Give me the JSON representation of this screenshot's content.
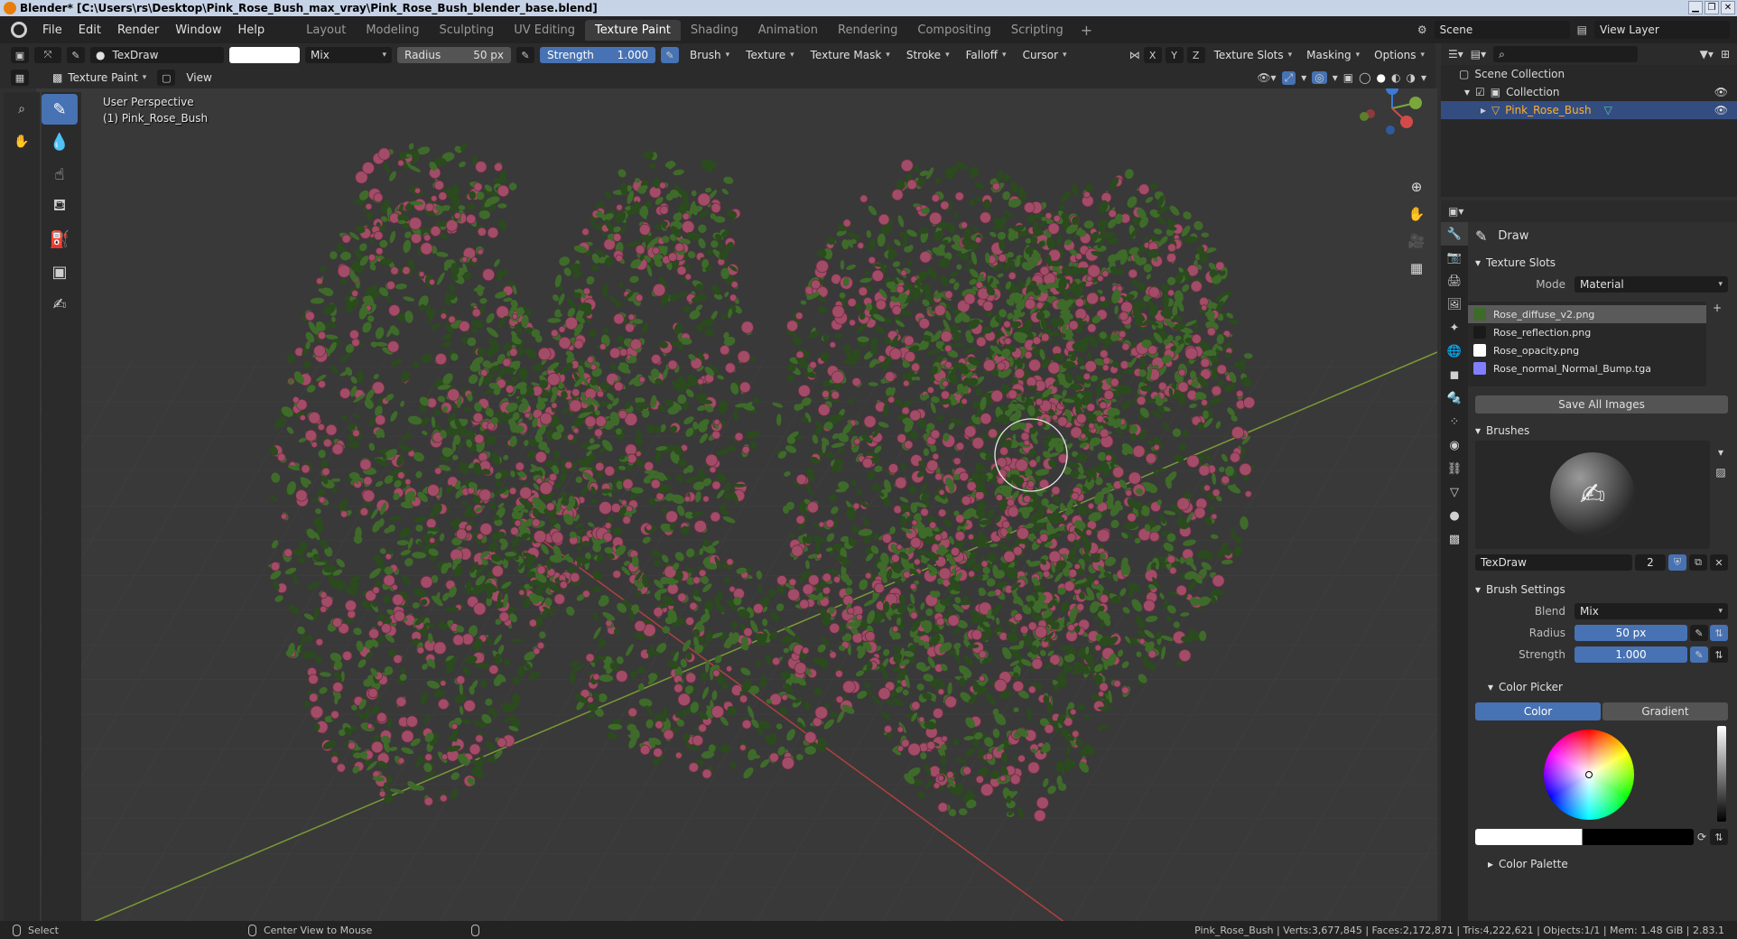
{
  "window": {
    "title": "Blender* [C:\\Users\\rs\\Desktop\\Pink_Rose_Bush_max_vray\\Pink_Rose_Bush_blender_base.blend]",
    "buttons": [
      "▁",
      "❐",
      "✕"
    ]
  },
  "menu": {
    "items": [
      "File",
      "Edit",
      "Render",
      "Window",
      "Help"
    ],
    "workspaces": [
      "Layout",
      "Modeling",
      "Sculpting",
      "UV Editing",
      "Texture Paint",
      "Shading",
      "Animation",
      "Rendering",
      "Compositing",
      "Scripting"
    ],
    "active_workspace": "Texture Paint",
    "scene": "Scene",
    "view_layer": "View Layer"
  },
  "tool_header": {
    "brush_name": "TexDraw",
    "blend": "Mix",
    "radius_label": "Radius",
    "radius_value": "50 px",
    "strength_label": "Strength",
    "strength_value": "1.000",
    "dropdowns": [
      "Brush",
      "Texture",
      "Texture Mask",
      "Stroke",
      "Falloff",
      "Cursor"
    ],
    "axes": [
      "X",
      "Y",
      "Z"
    ],
    "right_dropdowns": [
      "Texture Slots",
      "Masking",
      "Options"
    ]
  },
  "mode_header": {
    "mode": "Texture Paint",
    "view": "View"
  },
  "viewport": {
    "perspective": "User Perspective",
    "object": "(1) Pink_Rose_Bush",
    "brush_cursor_radius": 40
  },
  "outliner": {
    "scene_collection": "Scene Collection",
    "collection": "Collection",
    "object": "Pink_Rose_Bush"
  },
  "properties": {
    "tool_name": "Draw",
    "texture_slots_title": "Texture Slots",
    "mode_label": "Mode",
    "mode_value": "Material",
    "slots": [
      {
        "name": "Rose_diffuse_v2.png",
        "color": "#3f6b2a"
      },
      {
        "name": "Rose_reflection.png",
        "color": "#1a1a1a"
      },
      {
        "name": "Rose_opacity.png",
        "color": "#ffffff"
      },
      {
        "name": "Rose_normal_Normal_Bump.tga",
        "color": "#8080ff"
      }
    ],
    "save_all": "Save All Images",
    "brushes_title": "Brushes",
    "brush_name": "TexDraw",
    "brush_users": "2",
    "brush_settings_title": "Brush Settings",
    "blend_label": "Blend",
    "blend_value": "Mix",
    "radius_label": "Radius",
    "radius_value": "50 px",
    "strength_label": "Strength",
    "strength_value": "1.000",
    "color_picker_title": "Color Picker",
    "color_tab": "Color",
    "gradient_tab": "Gradient",
    "color_palette_title": "Color Palette"
  },
  "statusbar": {
    "select": "Select",
    "center": "Center View to Mouse",
    "stats": "Pink_Rose_Bush | Verts:3,677,845 | Faces:2,172,871 | Tris:4,222,621 | Objects:1/1 | Mem: 1.48 GiB | 2.83.1"
  },
  "colors": {
    "accent": "#4772b3",
    "selected_object": "#ffaf29",
    "leaf_dark": "#2b4a1e",
    "leaf": "#3f6b2a",
    "rose": "#a24c68"
  }
}
